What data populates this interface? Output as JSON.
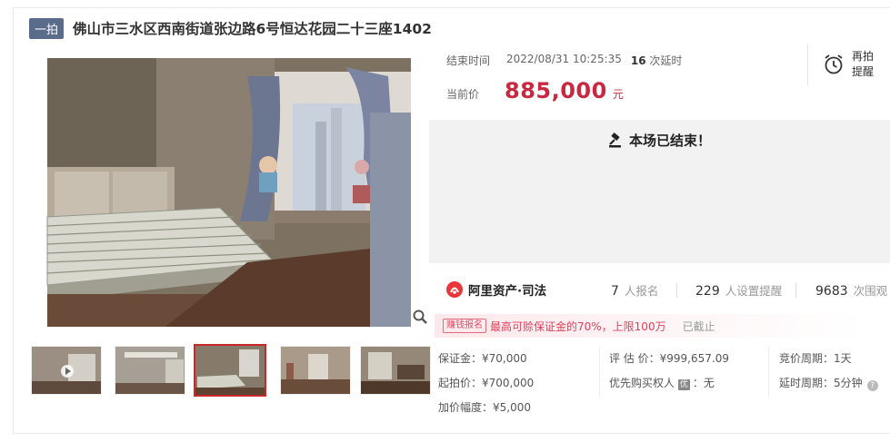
{
  "header": {
    "badge": "一拍",
    "title": "佛山市三水区西南街道张边路6号恒达花园二十三座1402"
  },
  "auction": {
    "end_label": "结束时间",
    "end_time": "2022/08/31 10:25:35",
    "delay_count": "16",
    "delay_suffix": "次延时",
    "price_label": "当前价",
    "price": "885,000",
    "unit": "元",
    "remind_line1": "再拍",
    "remind_line2": "提醒",
    "ended_text": "本场已结束！"
  },
  "stats": {
    "brand": "阿里资产·司法",
    "signups_count": "7",
    "signups_label": "人报名",
    "reminders_count": "229",
    "reminders_label": "人设置提醒",
    "views_count": "9683",
    "views_label": "次围观"
  },
  "notice": {
    "tag": "赚钱报名",
    "text": "最高可赊保证金的70%，上限100万",
    "status": "已截止"
  },
  "details": {
    "deposit": "保证金：¥70,000",
    "estimate": "评 估 价：¥999,657.09",
    "cycle": "竞价周期：1天",
    "start_price": "起拍价：¥700,000",
    "priority_label": "优先购买权人",
    "priority_tag": "优",
    "priority_value": "：无",
    "delay_cycle": "延时周期：5分钟",
    "increment": "加价幅度：¥5,000"
  },
  "colors": {
    "accent_price": "#c82840",
    "badge_bg": "#5a6b8c",
    "active_thumb_border": "#c82828"
  },
  "icons": [
    "gavel-icon",
    "alarm-clock-icon",
    "zoom-icon",
    "play-icon",
    "ali-brand-icon",
    "question-icon"
  ]
}
